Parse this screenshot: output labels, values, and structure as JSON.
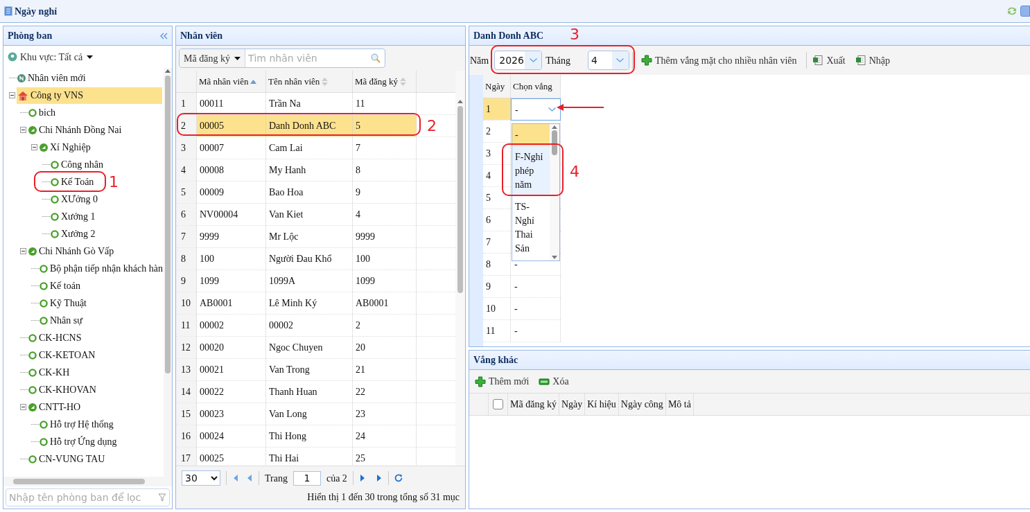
{
  "window": {
    "title": "Ngày nghỉ"
  },
  "departments": {
    "title": "Phòng ban",
    "region": "Khu vực: Tất cả",
    "filter_placeholder": "Nhập tên phòng ban để lọc",
    "tree": [
      {
        "label": "Nhân viên mới",
        "kind": "new",
        "selected": false
      },
      {
        "label": "Công ty VNS",
        "kind": "company",
        "selected": true,
        "children": [
          {
            "label": "bich",
            "kind": "leaf",
            "selected": false
          },
          {
            "label": "Chi Nhánh Đồng Nai",
            "kind": "branch",
            "selected": false,
            "children": [
              {
                "label": "Xí Nghiệp",
                "kind": "branch",
                "selected": false,
                "children": [
                  {
                    "label": "Công nhân",
                    "kind": "leaf",
                    "selected": false
                  },
                  {
                    "label": "Kế Toán",
                    "kind": "leaf",
                    "selected": false
                  },
                  {
                    "label": "XƯởng 0",
                    "kind": "leaf",
                    "selected": false
                  },
                  {
                    "label": "Xưởng 1",
                    "kind": "leaf",
                    "selected": false
                  },
                  {
                    "label": "Xưởng 2",
                    "kind": "leaf",
                    "selected": false
                  }
                ]
              }
            ]
          },
          {
            "label": "Chi Nhánh Gò Vấp",
            "kind": "branch",
            "selected": false,
            "children": [
              {
                "label": "Bộ phận tiếp nhận khách hàn",
                "kind": "leaf",
                "selected": false
              },
              {
                "label": "Kế toán",
                "kind": "leaf",
                "selected": false
              },
              {
                "label": "Kỹ Thuật",
                "kind": "leaf",
                "selected": false
              },
              {
                "label": "Nhân sự",
                "kind": "leaf",
                "selected": false
              }
            ]
          },
          {
            "label": "CK-HCNS",
            "kind": "leaf",
            "selected": false
          },
          {
            "label": "CK-KETOAN",
            "kind": "leaf",
            "selected": false
          },
          {
            "label": "CK-KH",
            "kind": "leaf",
            "selected": false
          },
          {
            "label": "CK-KHOVAN",
            "kind": "leaf",
            "selected": false
          },
          {
            "label": "CNTT-HO",
            "kind": "branch",
            "selected": false,
            "children": [
              {
                "label": "Hỗ trợ Hệ thống",
                "kind": "leaf",
                "selected": false
              },
              {
                "label": "Hỗ trợ Ứng dụng",
                "kind": "leaf",
                "selected": false
              }
            ]
          },
          {
            "label": "CN-VUNG TAU",
            "kind": "leaf",
            "selected": false
          }
        ]
      }
    ]
  },
  "employees": {
    "title": "Nhân viên",
    "search_by": "Mã đăng ký",
    "search_placeholder": "Tìm nhân viên",
    "columns": [
      {
        "label": "Mã nhân viên",
        "sorted": true
      },
      {
        "label": "Tên nhân viên",
        "sorted": false
      },
      {
        "label": "Mã đăng ký",
        "sorted": false
      }
    ],
    "rows": [
      {
        "index": "1",
        "code": "00011",
        "name": "Trần Na",
        "reg": "11",
        "selected": false
      },
      {
        "index": "2",
        "code": "00005",
        "name": "Danh Donh ABC",
        "reg": "5",
        "selected": true
      },
      {
        "index": "3",
        "code": "00007",
        "name": "Cam Lai",
        "reg": "7",
        "selected": false
      },
      {
        "index": "4",
        "code": "00008",
        "name": "My Hanh",
        "reg": "8",
        "selected": false
      },
      {
        "index": "5",
        "code": "00009",
        "name": "Bao Hoa",
        "reg": "9",
        "selected": false
      },
      {
        "index": "6",
        "code": "NV00004",
        "name": "Van Kiet",
        "reg": "4",
        "selected": false
      },
      {
        "index": "7",
        "code": "9999",
        "name": "Mr Lộc",
        "reg": "9999",
        "selected": false
      },
      {
        "index": "8",
        "code": "100",
        "name": "Người Đau Khổ",
        "reg": "100",
        "selected": false
      },
      {
        "index": "9",
        "code": "1099",
        "name": "1099A",
        "reg": "1099",
        "selected": false
      },
      {
        "index": "10",
        "code": "AB0001",
        "name": "Lê Minh Ký",
        "reg": "AB0001",
        "selected": false
      },
      {
        "index": "11",
        "code": "00002",
        "name": "00002",
        "reg": "2",
        "selected": false
      },
      {
        "index": "12",
        "code": "00020",
        "name": "Ngoc Chuyen",
        "reg": "20",
        "selected": false
      },
      {
        "index": "13",
        "code": "00021",
        "name": "Van Trong",
        "reg": "21",
        "selected": false
      },
      {
        "index": "14",
        "code": "00022",
        "name": "Thanh Huan",
        "reg": "22",
        "selected": false
      },
      {
        "index": "15",
        "code": "00023",
        "name": "Van Long",
        "reg": "23",
        "selected": false
      },
      {
        "index": "16",
        "code": "00024",
        "name": "Thi Hong",
        "reg": "24",
        "selected": false
      },
      {
        "index": "17",
        "code": "00025",
        "name": "Thi Hai",
        "reg": "25",
        "selected": false
      }
    ],
    "pager": {
      "page_size": "30",
      "page_label": "Trang",
      "page": "1",
      "of": "của 2",
      "summary": "Hiển thị 1 đến 30 trong tổng số 31 mục"
    }
  },
  "absence": {
    "title": "Danh Donh ABC",
    "year_label": "Năm",
    "year": "2026",
    "month_label": "Tháng",
    "month": "4",
    "actions": [
      {
        "label": "Thêm vắng mặt cho nhiều nhân viên",
        "kind": "add"
      },
      {
        "label": "Xuất",
        "kind": "excel"
      },
      {
        "label": "Nhập",
        "kind": "excel"
      }
    ],
    "columns": [
      "Ngày",
      "Chọn vắng"
    ],
    "rows": [
      {
        "day": "1",
        "value": "-",
        "selected": true,
        "kind": "editor"
      },
      {
        "day": "2",
        "selected": false,
        "kind": "cell"
      },
      {
        "day": "3",
        "selected": false,
        "kind": "cell"
      },
      {
        "day": "4",
        "selected": false,
        "kind": "cell"
      },
      {
        "day": "5",
        "selected": false,
        "kind": "cell"
      },
      {
        "day": "6",
        "selected": false,
        "kind": "cell"
      },
      {
        "day": "7",
        "selected": false,
        "kind": "cell"
      },
      {
        "day": "8",
        "value": "-",
        "selected": false,
        "kind": "cell"
      },
      {
        "day": "9",
        "value": "-",
        "selected": false,
        "kind": "cell"
      },
      {
        "day": "10",
        "value": "-",
        "selected": false,
        "kind": "cell"
      },
      {
        "day": "11",
        "value": "-",
        "selected": false,
        "kind": "cell"
      }
    ],
    "options": [
      {
        "label": "-",
        "selected": true,
        "hovered": false
      },
      {
        "label": "F-Nghỉ phép năm",
        "selected": false,
        "hovered": true
      },
      {
        "label": "TS-Nghỉ Thai Sản",
        "selected": false,
        "hovered": false
      }
    ]
  },
  "other_absence": {
    "title": "Vắng khác",
    "actions": [
      {
        "label": "Thêm mới",
        "kind": "add"
      },
      {
        "label": "Xóa",
        "kind": "remove"
      }
    ],
    "columns": [
      "Mã đăng ký",
      "Ngày",
      "Kí hiệu",
      "Ngày công",
      "Mô tả"
    ],
    "select_all": {
      "checked": false
    }
  },
  "annotations": [
    {
      "label": "1"
    },
    {
      "label": "2"
    },
    {
      "label": "3"
    },
    {
      "label": "4"
    }
  ]
}
